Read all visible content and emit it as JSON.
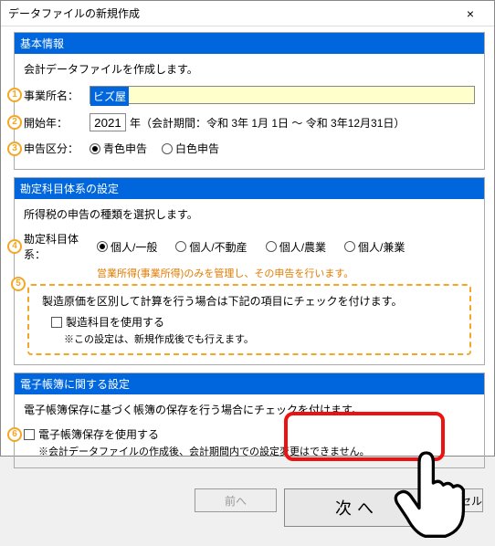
{
  "window": {
    "title": "データファイルの新規作成",
    "close_glyph": "×"
  },
  "sections": {
    "basic": {
      "header": "基本情報",
      "desc": "会計データファイルを作成します。",
      "office_label": "事業所名：",
      "office_value": "ビズ屋",
      "year_label": "開始年：",
      "year_value": "2021",
      "year_suffix": "年（会計期間：令和 3年 1月 1日 ～ 令和 3年12月31日）",
      "tax_label": "申告区分：",
      "tax_options": {
        "blue": "青色申告",
        "white": "白色申告"
      }
    },
    "account": {
      "header": "勘定科目体系の設定",
      "desc": "所得税の申告の種類を選択します。",
      "system_label": "勘定科目体系：",
      "options": {
        "general": "個人/一般",
        "realestate": "個人/不動産",
        "agri": "個人/農業",
        "combined": "個人/兼業"
      },
      "orange_note": "営業所得(事業所得)のみを管理し、その申告を行います。",
      "box_desc": "製造原価を区別して計算を行う場合は下記の項目にチェックを付けます。",
      "box_check": "製造科目を使用する",
      "box_note": "※この設定は、新規作成後でも行えます。"
    },
    "ebook": {
      "header": "電子帳簿に関する設定",
      "desc": "電子帳簿保存に基づく帳簿の保存を行う場合にチェックを付けます。",
      "check": "電子帳簿保存を使用する",
      "note": "※会計データファイルの作成後、会計期間内での設定変更はできません。"
    }
  },
  "buttons": {
    "prev": "前へ",
    "next": "次へ",
    "cancel": "ャンセル"
  },
  "markers": {
    "m1": "1",
    "m2": "2",
    "m3": "3",
    "m4": "4",
    "m5": "5",
    "m6": "6"
  }
}
